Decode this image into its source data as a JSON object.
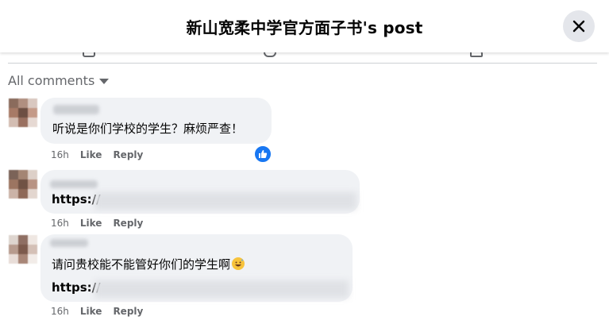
{
  "header": {
    "title": "新山宽柔中学官方面子书's post"
  },
  "sort": {
    "label": "All comments"
  },
  "comments": [
    {
      "text": "听说是你们学校的学生？麻烦严查！",
      "time": "16h",
      "like_label": "Like",
      "reply_label": "Reply",
      "reaction": "like-reaction-icon"
    },
    {
      "text": "https://",
      "time": "16h",
      "like_label": "Like",
      "reply_label": "Reply"
    },
    {
      "text": "请问贵校能不能管好你们的学生啊",
      "emoji": "grinning-sweat-emoji",
      "link": "https://",
      "time": "16h",
      "like_label": "Like",
      "reply_label": "Reply"
    }
  ],
  "colors": {
    "bubble": "#f0f2f5",
    "secondary_text": "#65676b",
    "like_blue": "#1877f2"
  }
}
